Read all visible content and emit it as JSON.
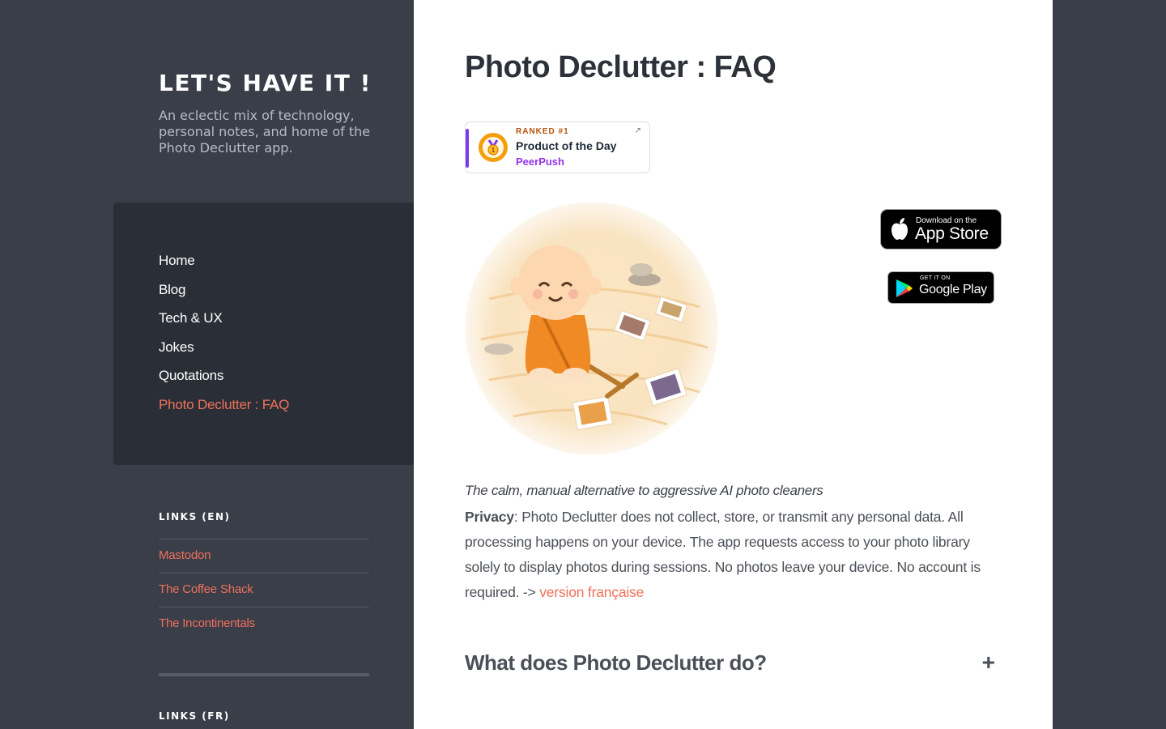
{
  "site": {
    "title": "LET'S HAVE IT !",
    "description": "An eclectic mix of technology, personal notes, and home of the Photo Declutter app."
  },
  "nav": {
    "items": [
      {
        "label": "Home"
      },
      {
        "label": "Blog"
      },
      {
        "label": "Tech & UX"
      },
      {
        "label": "Jokes"
      },
      {
        "label": "Quotations"
      },
      {
        "label": "Photo Declutter : FAQ"
      }
    ],
    "active_index": 5
  },
  "links_en": {
    "title": "LINKS (EN)",
    "items": [
      {
        "label": "Mastodon"
      },
      {
        "label": "The Coffee Shack"
      },
      {
        "label": "The Incontinentals"
      }
    ]
  },
  "links_fr": {
    "title": "LINKS (FR)"
  },
  "page": {
    "title": "Photo Declutter : FAQ",
    "badge": {
      "ranked": "RANKED #1",
      "headline": "Product of the Day",
      "brand": "PeerPush",
      "arrow": "↗"
    },
    "app_store": {
      "small": "Download on the",
      "big": "App Store"
    },
    "google_play": {
      "small": "GET IT ON",
      "big": "Google Play"
    },
    "tagline": "The calm, manual alternative to aggressive AI photo cleaners",
    "privacy_label": "Privacy",
    "privacy_text": ": Photo Declutter does not collect, store, or transmit any personal data. All processing happens on your device. The app requests access to your photo library solely to display photos during sessions. No photos leave your device. No account is required. -> ",
    "privacy_link": "version française",
    "faq": [
      {
        "question": "What does Photo Declutter do?",
        "toggle": "+"
      }
    ]
  },
  "colors": {
    "sidebar_bg": "#393e49",
    "nav_panel_bg": "#2a2f37",
    "accent": "#f0705a",
    "main_bg": "#ffffff",
    "badge_brand": "#9333ea"
  }
}
